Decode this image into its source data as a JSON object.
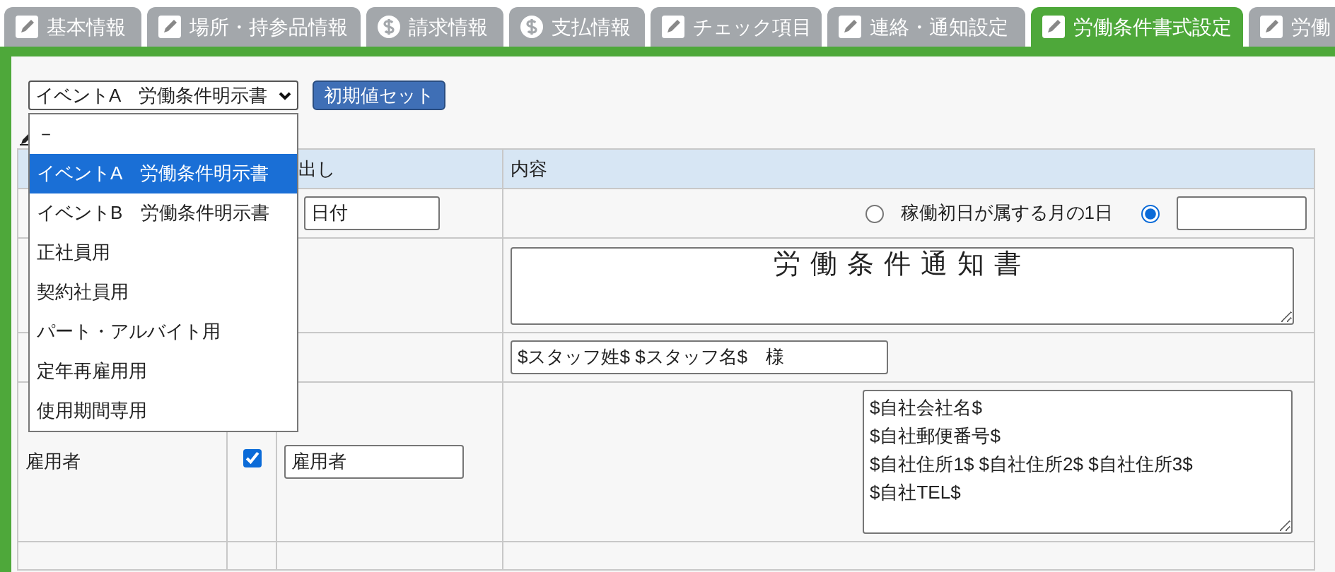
{
  "tabs": [
    {
      "label": "基本情報",
      "kind": "edit",
      "selected": false
    },
    {
      "label": "場所・持参品情報",
      "kind": "edit",
      "selected": false
    },
    {
      "label": "請求情報",
      "kind": "payment",
      "selected": false
    },
    {
      "label": "支払情報",
      "kind": "payment",
      "selected": false
    },
    {
      "label": "チェック項目",
      "kind": "edit",
      "selected": false
    },
    {
      "label": "連絡・通知設定",
      "kind": "edit",
      "selected": false
    },
    {
      "label": "労働条件書式設定",
      "kind": "edit",
      "selected": true
    },
    {
      "label": "労働",
      "kind": "edit",
      "selected": false
    }
  ],
  "template_select": {
    "value": "イベントA　労働条件明示書",
    "expanded": true,
    "options": [
      {
        "label": "－",
        "selected": false
      },
      {
        "label": "イベントA　労働条件明示書",
        "selected": true
      },
      {
        "label": "イベントB　労働条件明示書",
        "selected": false
      },
      {
        "label": "正社員用",
        "selected": false
      },
      {
        "label": "契約社員用",
        "selected": false
      },
      {
        "label": "パート・アルバイト用",
        "selected": false
      },
      {
        "label": "定年再雇用用",
        "selected": false
      },
      {
        "label": "使用期間専用",
        "selected": false
      }
    ]
  },
  "reset_button": "初期値セット",
  "table": {
    "columns": {
      "column_3": "出し",
      "column_4": "内容"
    },
    "rows": [
      {
        "kind": "date",
        "heading": "日付",
        "options": [
          {
            "kind": "label",
            "label": "稼働初日が属する月の1日",
            "selected": false
          },
          {
            "kind": "field",
            "selected": true
          }
        ]
      },
      {
        "kind": "title",
        "content": "労働条件通知書"
      },
      {
        "kind": "name",
        "content": "$スタッフ姓$ $スタッフ名$　様"
      },
      {
        "kind": "employer",
        "label": "雇用者",
        "shown": true,
        "heading": "雇用者",
        "content": "$自社会社名$\n$自社郵便番号$\n$自社住所1$ $自社住所2$ $自社住所3$\n$自社TEL$"
      }
    ]
  }
}
